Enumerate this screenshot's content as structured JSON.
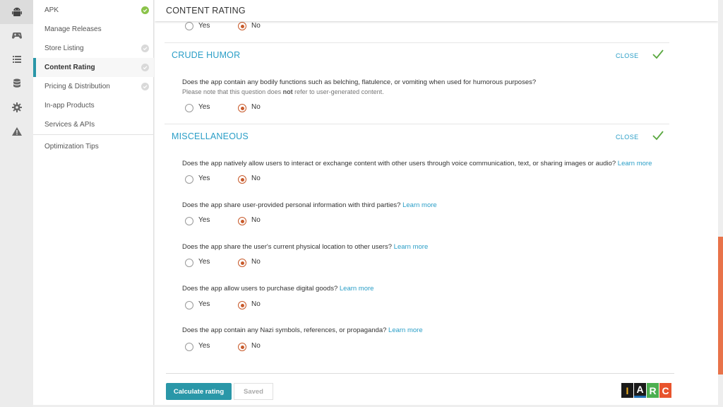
{
  "colors": {
    "accent": "#2a97a8",
    "link": "#2a9ec7",
    "radio_checked": "#c85a2b",
    "check_green": "#5aa840",
    "scroll_thumb": "#e8734a"
  },
  "rail": {
    "icons": [
      "android-icon",
      "gamepad-icon",
      "list-icon",
      "database-icon",
      "gear-icon",
      "warning-icon"
    ]
  },
  "nav": {
    "items": [
      {
        "label": "APK",
        "status": "done"
      },
      {
        "label": "Manage Releases",
        "status": "none"
      },
      {
        "label": "Store Listing",
        "status": "pending"
      },
      {
        "label": "Content Rating",
        "status": "pending"
      },
      {
        "label": "Pricing & Distribution",
        "status": "pending"
      },
      {
        "label": "In-app Products",
        "status": "none"
      },
      {
        "label": "Services & APIs",
        "status": "none"
      }
    ],
    "extra": "Optimization Tips"
  },
  "header": {
    "title": "CONTENT RATING"
  },
  "options": {
    "yes": "Yes",
    "no": "No"
  },
  "sections": {
    "crude": {
      "title": "CRUDE HUMOR",
      "close": "CLOSE",
      "question": "Does the app contain any bodily functions such as belching, flatulence, or vomiting when used for humorous purposes?",
      "note_pre": "Please note that this question does ",
      "note_bold": "not",
      "note_post": " refer to user-generated content."
    },
    "misc": {
      "title": "MISCELLANEOUS",
      "close": "CLOSE",
      "questions": [
        {
          "text": "Does the app natively allow users to interact or exchange content with other users through voice communication, text, or sharing images or audio?",
          "link": "Learn more"
        },
        {
          "text": "Does the app share user-provided personal information with third parties?",
          "link": "Learn more"
        },
        {
          "text": "Does the app share the user's current physical location to other users?",
          "link": "Learn more"
        },
        {
          "text": "Does the app allow users to purchase digital goods?",
          "link": "Learn more"
        },
        {
          "text": "Does the app contain any Nazi symbols, references, or propaganda?",
          "link": "Learn more"
        }
      ]
    }
  },
  "footer": {
    "calculate": "Calculate rating",
    "saved": "Saved",
    "iarc": [
      "I",
      "A",
      "R",
      "C"
    ],
    "iarc_colors": [
      "#f2b01e",
      "#1f6fb5",
      "#4caf50",
      "#e8542d"
    ]
  }
}
